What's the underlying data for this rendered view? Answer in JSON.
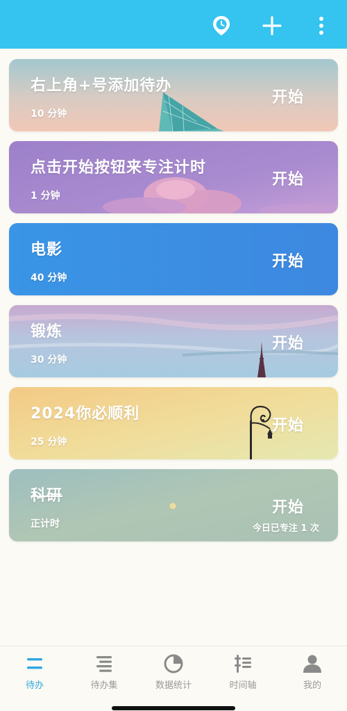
{
  "topbar": {
    "icons": [
      "location-timer-icon",
      "plus-icon",
      "more-vertical-icon"
    ],
    "color": "#35c3ef"
  },
  "tasks": [
    {
      "title": "右上角+号添加待办",
      "subtitle": "10 分钟",
      "action": "开始",
      "note": "",
      "strikethrough": false
    },
    {
      "title": "点击开始按钮来专注计时",
      "subtitle": "1 分钟",
      "action": "开始",
      "note": "",
      "strikethrough": false
    },
    {
      "title": "电影",
      "subtitle": "40 分钟",
      "action": "开始",
      "note": "",
      "strikethrough": false
    },
    {
      "title": "锻炼",
      "subtitle": "30 分钟",
      "action": "开始",
      "note": "",
      "strikethrough": false
    },
    {
      "title": "2024你必顺利",
      "subtitle": "25 分钟",
      "action": "开始",
      "note": "",
      "strikethrough": false
    },
    {
      "title": "科研",
      "subtitle": "正计时",
      "action": "开始",
      "note": "今日已专注 1 次",
      "strikethrough": true
    }
  ],
  "bottom_nav": {
    "items": [
      {
        "label": "待办",
        "icon": "todo-list-icon",
        "active": true
      },
      {
        "label": "待办集",
        "icon": "todo-collection-icon",
        "active": false
      },
      {
        "label": "数据统计",
        "icon": "pie-chart-icon",
        "active": false
      },
      {
        "label": "时间轴",
        "icon": "timeline-icon",
        "active": false
      },
      {
        "label": "我的",
        "icon": "profile-icon",
        "active": false
      }
    ],
    "active_color": "#2ea7e0",
    "inactive_color": "#9a9a9a"
  }
}
